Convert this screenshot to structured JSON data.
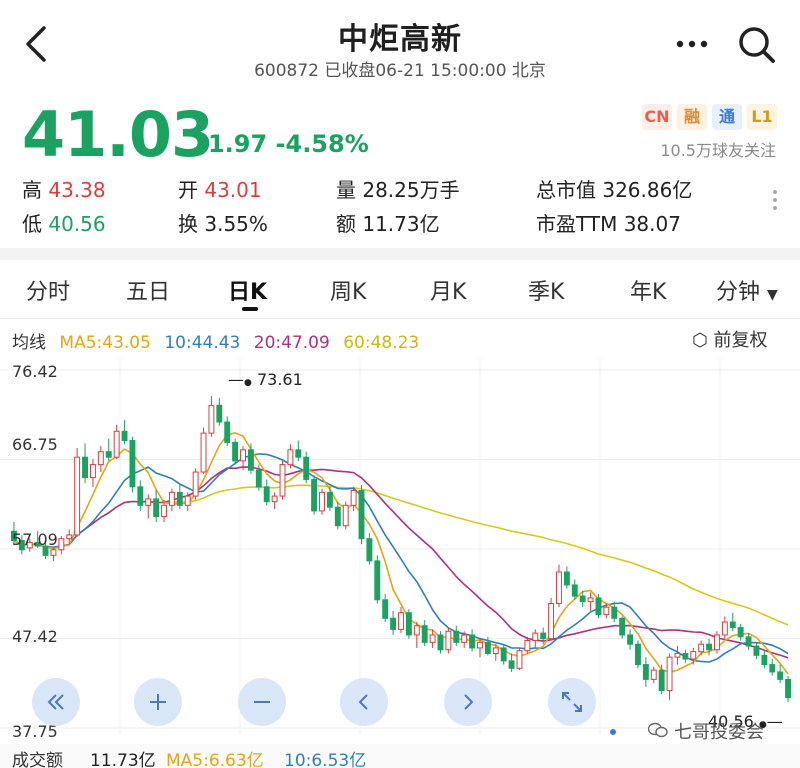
{
  "header": {
    "title": "中炬高新",
    "subtitle": "600872 已收盘06-21 15:00:00 北京"
  },
  "quote": {
    "price": "41.03",
    "change": "-1.97 -4.58%",
    "badges": [
      "CN",
      "融",
      "通",
      "L1"
    ],
    "followers": "10.5万球友关注",
    "up_color": "#e03b3b",
    "down_color": "#1aa260"
  },
  "stats": {
    "high_label": "高",
    "high_value": "43.38",
    "open_label": "开",
    "open_value": "43.01",
    "volume_label": "量",
    "volume_value": "28.25万手",
    "mktcap_label": "总市值",
    "mktcap_value": "326.86亿",
    "low_label": "低",
    "low_value": "40.56",
    "turnover_label": "换",
    "turnover_value": "3.55%",
    "amount_label": "额",
    "amount_value": "11.73亿",
    "pe_label": "市盈TTM",
    "pe_value": "38.07"
  },
  "tabs": [
    "分时",
    "五日",
    "日K",
    "周K",
    "月K",
    "季K",
    "年K",
    "分钟"
  ],
  "active_tab": "日K",
  "ma": {
    "label": "均线",
    "ma5": "MA5:43.05",
    "ma10": "10:44.43",
    "ma20": "20:47.09",
    "ma60": "60:48.23",
    "colors": {
      "ma5": "#e8a317",
      "ma10": "#2f7fc0",
      "ma20": "#b0307c",
      "ma60": "#d8c81a"
    }
  },
  "adjust_label": "前复权",
  "chart_data": {
    "type": "candlestick",
    "y_ticks": [
      "76.42",
      "66.75",
      "57.09",
      "47.42",
      "37.75"
    ],
    "ylim": [
      37.75,
      76.42
    ],
    "high_marker": "73.61",
    "low_marker": "40.56",
    "up_color": "#e03b3b",
    "down_color": "#1aa260",
    "candles": [
      [
        59,
        60,
        57.5,
        58
      ],
      [
        58,
        58.6,
        56.5,
        57
      ],
      [
        57.2,
        58.2,
        56.8,
        57.8
      ],
      [
        57.8,
        59,
        57.2,
        57.4
      ],
      [
        57.4,
        58,
        56,
        56.4
      ],
      [
        56.4,
        57.2,
        55.8,
        57
      ],
      [
        57,
        58.5,
        56.5,
        58.2
      ],
      [
        58.2,
        59.2,
        57.6,
        58.6
      ],
      [
        58.6,
        68,
        58.4,
        67
      ],
      [
        67,
        68.5,
        64.2,
        64.8
      ],
      [
        64.8,
        66.8,
        63.8,
        66.2
      ],
      [
        66.2,
        68.2,
        65.4,
        67.6
      ],
      [
        67.6,
        69,
        66.6,
        67
      ],
      [
        67,
        70.5,
        66.8,
        69.8
      ],
      [
        69.8,
        71,
        68.4,
        68.8
      ],
      [
        68.8,
        69.2,
        63.2,
        63.8
      ],
      [
        63.8,
        64.5,
        61.2,
        61.8
      ],
      [
        61.8,
        63,
        60.4,
        62.5
      ],
      [
        62.5,
        63.5,
        60,
        60.6
      ],
      [
        60.6,
        62.4,
        60,
        61.8
      ],
      [
        61.8,
        63.6,
        61.2,
        63.2
      ],
      [
        63.2,
        64,
        61.4,
        61.8
      ],
      [
        61.8,
        63.2,
        61.2,
        62.8
      ],
      [
        62.8,
        65.8,
        62.4,
        65.4
      ],
      [
        65.4,
        70.2,
        65.2,
        69.6
      ],
      [
        69.6,
        73.6,
        69.2,
        72.6
      ],
      [
        72.6,
        73.4,
        70.4,
        70.8
      ],
      [
        70.8,
        71.4,
        68.2,
        68.6
      ],
      [
        68.6,
        69,
        66.2,
        66.6
      ],
      [
        66.6,
        68.2,
        65.6,
        67.8
      ],
      [
        67.8,
        68.5,
        65.2,
        65.6
      ],
      [
        65.6,
        66.2,
        63.4,
        63.8
      ],
      [
        63.8,
        64.6,
        61.8,
        62.2
      ],
      [
        62.2,
        63.2,
        61.4,
        62.8
      ],
      [
        62.8,
        66.6,
        62.4,
        66.2
      ],
      [
        66.2,
        68.4,
        65.8,
        67.8
      ],
      [
        67.8,
        68.8,
        66.6,
        67
      ],
      [
        67,
        67.6,
        64.2,
        64.6
      ],
      [
        64.6,
        65,
        60.8,
        61.2
      ],
      [
        61.2,
        63.6,
        60.8,
        63.2
      ],
      [
        63.2,
        63.8,
        61.2,
        61.6
      ],
      [
        61.6,
        62.2,
        59.2,
        59.6
      ],
      [
        59.6,
        62.2,
        59.2,
        61.8
      ],
      [
        61.8,
        63.8,
        61.2,
        63.4
      ],
      [
        63.4,
        64,
        57.6,
        58.2
      ],
      [
        58.2,
        58.8,
        55.4,
        55.8
      ],
      [
        55.8,
        56.4,
        51.2,
        51.6
      ],
      [
        51.6,
        52.2,
        49.2,
        49.6
      ],
      [
        49.6,
        50.4,
        47.8,
        48.4
      ],
      [
        48.4,
        50.8,
        48,
        50.2
      ],
      [
        50.2,
        50.6,
        47.4,
        47.8
      ],
      [
        47.8,
        49.2,
        46.4,
        48.8
      ],
      [
        48.8,
        49.4,
        46.6,
        47
      ],
      [
        47,
        48.4,
        46.4,
        47.8
      ],
      [
        47.8,
        48.2,
        45.8,
        46.2
      ],
      [
        46.2,
        48.6,
        45.8,
        48.2
      ],
      [
        48.2,
        48.8,
        46.6,
        47
      ],
      [
        47,
        48.2,
        46.4,
        47.8
      ],
      [
        47.8,
        48.4,
        46,
        46.4
      ],
      [
        46.4,
        47.4,
        45.4,
        47
      ],
      [
        47,
        47.6,
        45.6,
        45.8
      ],
      [
        45.8,
        46.8,
        45,
        46.4
      ],
      [
        46.4,
        46.8,
        44.6,
        45
      ],
      [
        45,
        45.8,
        43.8,
        44.2
      ],
      [
        44.2,
        46.4,
        44,
        46.1
      ],
      [
        46.1,
        47.6,
        45.8,
        47.2
      ],
      [
        47.2,
        48.4,
        46.4,
        48
      ],
      [
        48,
        48.6,
        46.8,
        47.4
      ],
      [
        47.4,
        51.8,
        47.2,
        51.2
      ],
      [
        51.2,
        55.4,
        50.8,
        54.6
      ],
      [
        54.6,
        55.2,
        52.8,
        53.2
      ],
      [
        53.2,
        53.8,
        51.6,
        52
      ],
      [
        52,
        52.6,
        50.8,
        51.4
      ],
      [
        51.4,
        52.4,
        50.4,
        51.8
      ],
      [
        51.8,
        52.2,
        49.6,
        50
      ],
      [
        50,
        51.2,
        49.6,
        50.8
      ],
      [
        50.8,
        51.4,
        49.2,
        49.6
      ],
      [
        49.6,
        49.8,
        47.4,
        47.8
      ],
      [
        47.8,
        48.4,
        46.2,
        46.8
      ],
      [
        46.8,
        47.2,
        44.2,
        44.6
      ],
      [
        44.6,
        45.4,
        42.2,
        43
      ],
      [
        43,
        44.4,
        42.6,
        44
      ],
      [
        44,
        44.6,
        41.4,
        41.8
      ],
      [
        41.8,
        45.8,
        40.8,
        45.4
      ],
      [
        45.4,
        46.6,
        44.6,
        45.8
      ],
      [
        45.8,
        46.2,
        44.8,
        45.2
      ],
      [
        45.2,
        46.4,
        44.6,
        46
      ],
      [
        46,
        47.2,
        45.6,
        46.8
      ],
      [
        46.8,
        47.4,
        45.6,
        46.2
      ],
      [
        46.2,
        48.2,
        45.8,
        47.8
      ],
      [
        47.8,
        49.8,
        47.4,
        49.2
      ],
      [
        49.2,
        50.2,
        48.2,
        48.6
      ],
      [
        48.6,
        49,
        47.2,
        47.6
      ],
      [
        47.6,
        48,
        46.2,
        46.6
      ],
      [
        46.6,
        47,
        45.2,
        45.6
      ],
      [
        45.6,
        46.2,
        44.2,
        44.6
      ],
      [
        44.6,
        45.2,
        43.4,
        43.8
      ],
      [
        43.8,
        44.6,
        42.6,
        43
      ],
      [
        43,
        43.38,
        40.56,
        41.03
      ]
    ]
  },
  "controls": [
    "fast-rewind",
    "zoom-in",
    "zoom-out",
    "prev",
    "next",
    "fullscreen"
  ],
  "volume_row": {
    "label": "成交额",
    "value": "11.73亿",
    "ma5": "MA5:6.63亿",
    "ma10": "10:6.53亿"
  },
  "watermark": "七哥投委会"
}
